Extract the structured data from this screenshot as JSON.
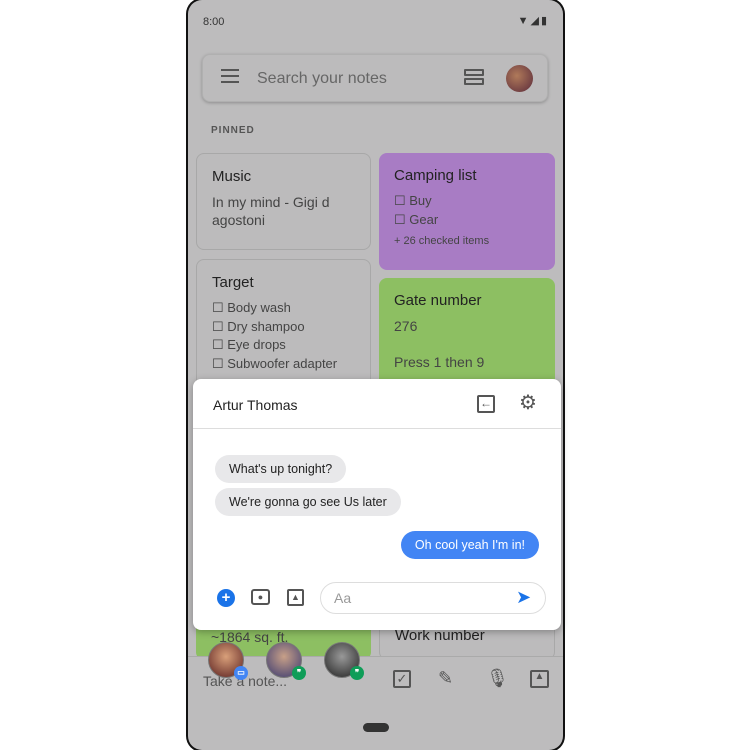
{
  "status": {
    "time": "8:00"
  },
  "search": {
    "placeholder": "Search your notes"
  },
  "section": "PINNED",
  "notes": {
    "music": {
      "title": "Music",
      "body": "In my mind - Gigi d agostoni"
    },
    "camping": {
      "title": "Camping list",
      "items": [
        "☐ Buy",
        "☐ Gear"
      ],
      "more": "+ 26 checked items",
      "color": "#a87cc4"
    },
    "target": {
      "title": "Target",
      "items": [
        "☐ Body wash",
        "☐ Dry shampoo",
        "☐ Eye drops",
        "☐ Subwoofer adapter"
      ]
    },
    "gate": {
      "title": "Gate number",
      "line1": "276",
      "line2": "Press 1 then 9",
      "color": "#8dbf62"
    },
    "sqft": {
      "body": "~1864 sq. ft."
    },
    "work": {
      "title": "Work number"
    }
  },
  "chat": {
    "contact": "Artur Thomas",
    "messages": [
      {
        "text": "What's up tonight?",
        "from": "them"
      },
      {
        "text": "We're gonna go see Us later",
        "from": "them"
      },
      {
        "text": "Oh cool yeah I'm in!",
        "from": "me"
      }
    ],
    "input_placeholder": "Aa",
    "accent": "#1a73e8"
  },
  "bottom_bar": {
    "placeholder": "Take a note..."
  }
}
